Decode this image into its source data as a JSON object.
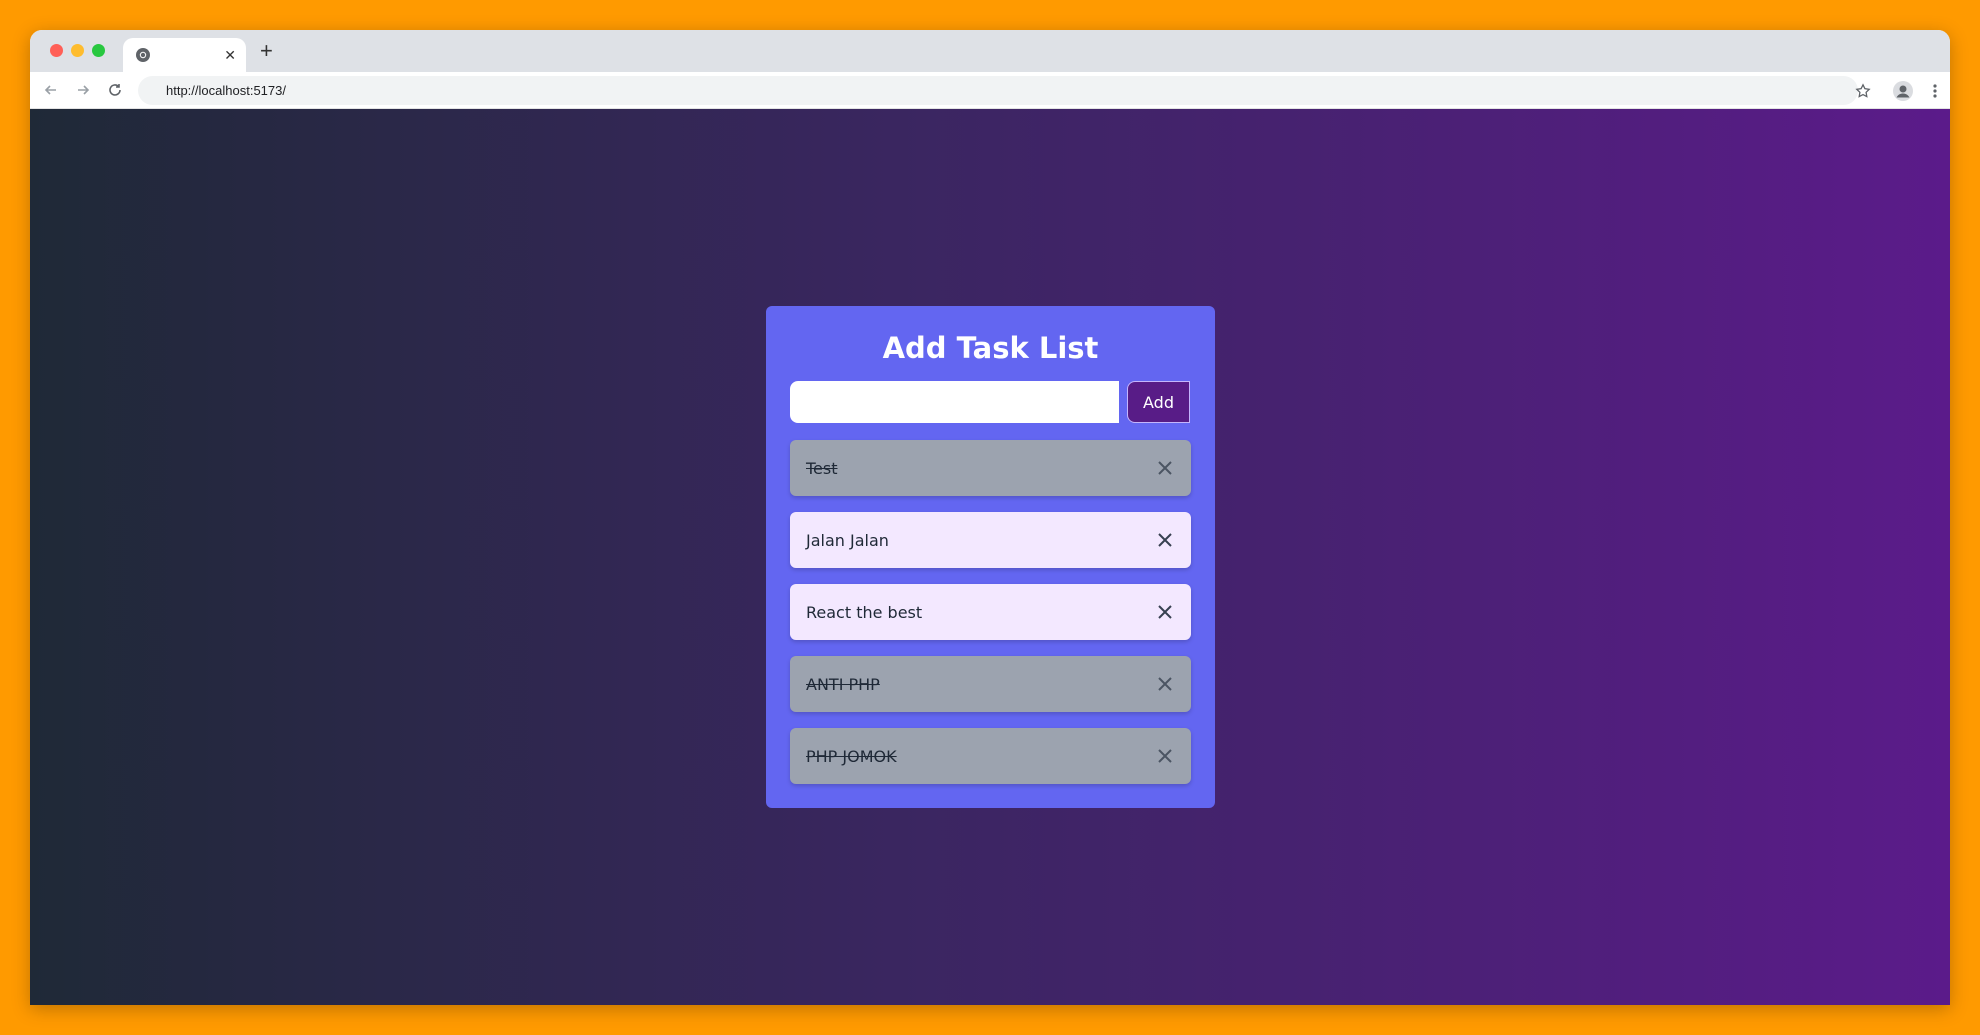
{
  "browser": {
    "tab_close": "✕",
    "new_tab": "+",
    "url": "http://localhost:5173/"
  },
  "app": {
    "title": "Add Task List",
    "input_value": "",
    "add_label": "Add",
    "tasks": [
      {
        "text": "Test",
        "done": true
      },
      {
        "text": "Jalan Jalan",
        "done": false
      },
      {
        "text": "React the best",
        "done": false
      },
      {
        "text": "ANTI PHP",
        "done": true
      },
      {
        "text": "PHP JOMOK",
        "done": true
      }
    ]
  },
  "colors": {
    "page_background": "#ff9a00",
    "card": "#6366f1",
    "add_button": "#581c87",
    "task_done": "#9ca3af",
    "task_active": "#f3e8ff"
  },
  "icons": {
    "tab_favicon": "chrome-icon",
    "back": "arrow-left-icon",
    "forward": "arrow-right-icon",
    "reload": "reload-icon",
    "bookmark": "star-icon",
    "profile": "profile-icon",
    "menu": "kebab-menu-icon",
    "task_delete": "close-icon"
  }
}
